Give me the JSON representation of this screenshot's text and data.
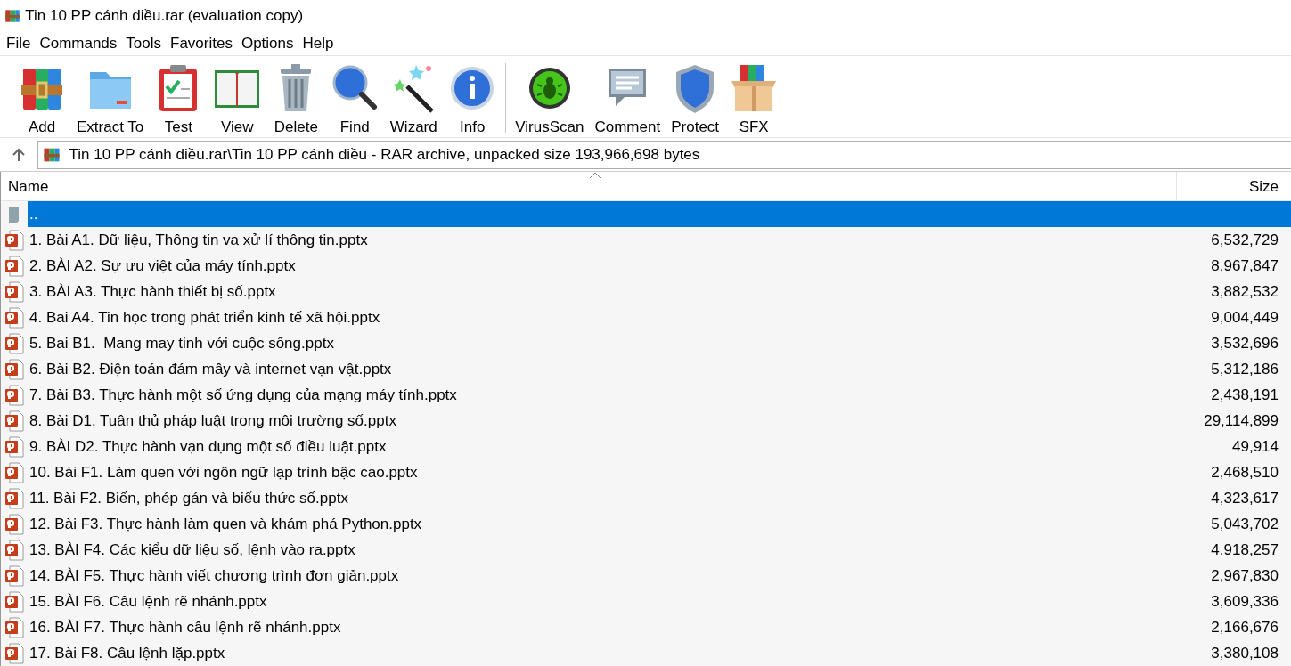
{
  "window": {
    "title": "Tin 10 PP cánh diều.rar (evaluation copy)"
  },
  "menu": [
    "File",
    "Commands",
    "Tools",
    "Favorites",
    "Options",
    "Help"
  ],
  "toolbar_groups": [
    {
      "buttons": [
        {
          "label": "Add",
          "kind": "add"
        },
        {
          "label": "Extract To",
          "kind": "extract"
        },
        {
          "label": "Test",
          "kind": "test"
        },
        {
          "label": "View",
          "kind": "view"
        },
        {
          "label": "Delete",
          "kind": "delete"
        },
        {
          "label": "Find",
          "kind": "find"
        },
        {
          "label": "Wizard",
          "kind": "wizard"
        },
        {
          "label": "Info",
          "kind": "info"
        }
      ]
    },
    {
      "buttons": [
        {
          "label": "VirusScan",
          "kind": "virus"
        },
        {
          "label": "Comment",
          "kind": "comment"
        },
        {
          "label": "Protect",
          "kind": "protect"
        },
        {
          "label": "SFX",
          "kind": "sfx"
        }
      ]
    }
  ],
  "address_bar": {
    "path": "Tin 10 PP cánh diều.rar\\Tin 10 PP cánh diều - RAR archive, unpacked size 193,966,698 bytes"
  },
  "table": {
    "columns": [
      {
        "label": "Name",
        "sorted": true
      },
      {
        "label": "Size",
        "sorted": false
      }
    ],
    "rows": [
      {
        "kind": "parent",
        "name": "..",
        "size": "",
        "selected": true
      },
      {
        "kind": "file",
        "name": "1. Bài A1. Dữ liệu, Thông tin va xử lí thông tin.pptx",
        "size": "6,532,729",
        "selected": false
      },
      {
        "kind": "file",
        "name": "2. BÀI A2. Sự ưu việt của máy tính.pptx",
        "size": "8,967,847",
        "selected": false
      },
      {
        "kind": "file",
        "name": "3. BÀI A3. Thực hành thiết bị số.pptx",
        "size": "3,882,532",
        "selected": false
      },
      {
        "kind": "file",
        "name": "4. Bai A4. Tin học trong phát triển kinh tế xã hội.pptx",
        "size": "9,004,449",
        "selected": false
      },
      {
        "kind": "file",
        "name": "5. Bai B1.  Mang may tinh với cuộc sống.pptx",
        "size": "3,532,696",
        "selected": false
      },
      {
        "kind": "file",
        "name": "6. Bài B2. Điện toán đám mây và internet vạn vật.pptx",
        "size": "5,312,186",
        "selected": false
      },
      {
        "kind": "file",
        "name": "7. Bài B3. Thực hành một số ứng dụng của mạng máy tính.pptx",
        "size": "2,438,191",
        "selected": false
      },
      {
        "kind": "file",
        "name": "8. Bài D1. Tuân thủ pháp luật trong môi trường số.pptx",
        "size": "29,114,899",
        "selected": false
      },
      {
        "kind": "file",
        "name": "9. BÀI D2. Thực hành vạn dụng một số điều luật.pptx",
        "size": "49,914",
        "selected": false
      },
      {
        "kind": "file",
        "name": "10. Bài F1. Làm quen với ngôn ngữ lạp trình bậc cao.pptx",
        "size": "2,468,510",
        "selected": false
      },
      {
        "kind": "file",
        "name": "11. Bài F2. Biến, phép gán và biểu thức số.pptx",
        "size": "4,323,617",
        "selected": false
      },
      {
        "kind": "file",
        "name": "12. Bài F3. Thực hành làm quen và khám phá Python.pptx",
        "size": "5,043,702",
        "selected": false
      },
      {
        "kind": "file",
        "name": "13. BÀI F4. Các kiểu dữ liệu số, lệnh vào ra.pptx",
        "size": "4,918,257",
        "selected": false
      },
      {
        "kind": "file",
        "name": "14. BÀI F5. Thực hành viết chương trình đơn giản.pptx",
        "size": "2,967,830",
        "selected": false
      },
      {
        "kind": "file",
        "name": "15. BÀI F6. Câu lệnh rẽ nhánh.pptx",
        "size": "3,609,336",
        "selected": false
      },
      {
        "kind": "file",
        "name": "16. BÀI F7. Thực hành câu lệnh rẽ nhánh.pptx",
        "size": "2,166,676",
        "selected": false
      },
      {
        "kind": "file",
        "name": "17. Bài F8. Câu lệnh lặp.pptx",
        "size": "3,380,108",
        "selected": false
      }
    ]
  }
}
